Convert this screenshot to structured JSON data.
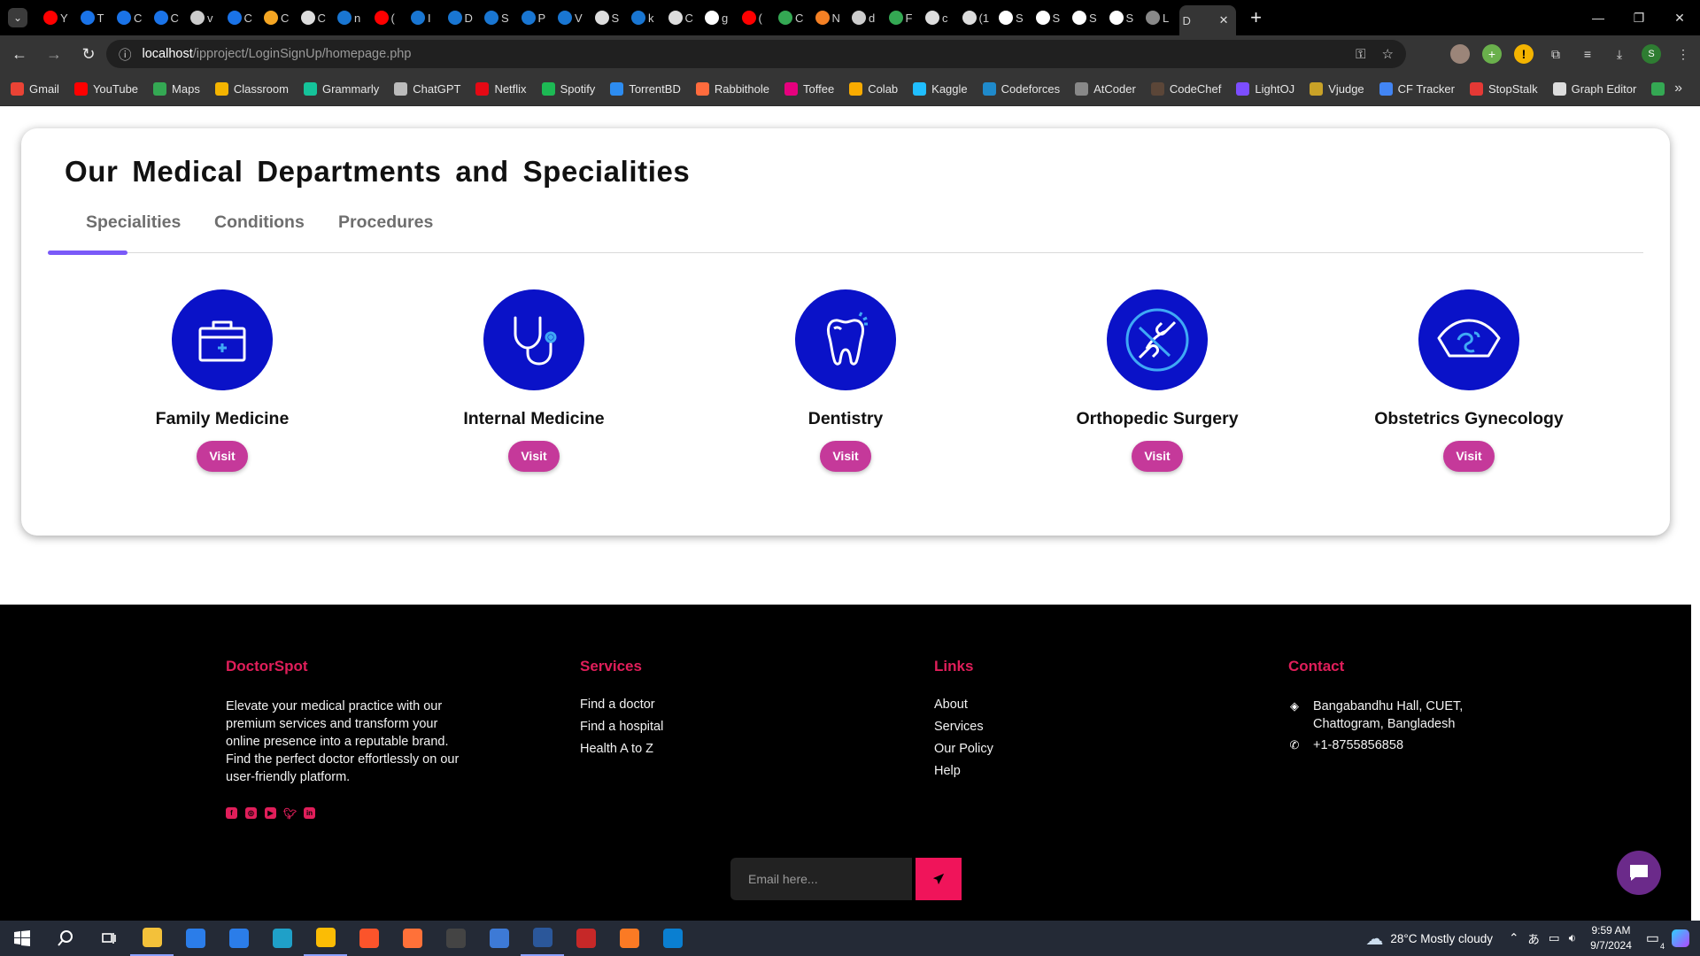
{
  "browser": {
    "tabs": [
      {
        "glyph": "Y",
        "color": "#ff0000"
      },
      {
        "glyph": "T",
        "color": "#1a73e8"
      },
      {
        "glyph": "C",
        "color": "#1a73e8"
      },
      {
        "glyph": "C",
        "color": "#1a73e8"
      },
      {
        "glyph": "v",
        "color": "#cccccc"
      },
      {
        "glyph": "C",
        "color": "#1a73e8"
      },
      {
        "glyph": "C",
        "color": "#f5a623"
      },
      {
        "glyph": "C",
        "color": "#dddddd"
      },
      {
        "glyph": "n",
        "color": "#1976d2"
      },
      {
        "glyph": "(",
        "color": "#ff0000"
      },
      {
        "glyph": "I",
        "color": "#1976d2"
      },
      {
        "glyph": "D",
        "color": "#1976d2"
      },
      {
        "glyph": "S",
        "color": "#1976d2"
      },
      {
        "glyph": "P",
        "color": "#1976d2"
      },
      {
        "glyph": "V",
        "color": "#1976d2"
      },
      {
        "glyph": "S",
        "color": "#dddddd"
      },
      {
        "glyph": "k",
        "color": "#1976d2"
      },
      {
        "glyph": "C",
        "color": "#dddddd"
      },
      {
        "glyph": "g",
        "color": "#ffffff"
      },
      {
        "glyph": "(",
        "color": "#ff0000"
      },
      {
        "glyph": "C",
        "color": "#34a853"
      },
      {
        "glyph": "N",
        "color": "#f48024"
      },
      {
        "glyph": "d",
        "color": "#cccccc"
      },
      {
        "glyph": "F",
        "color": "#34a853"
      },
      {
        "glyph": "c",
        "color": "#dddddd"
      },
      {
        "glyph": "(1",
        "color": "#dddddd"
      },
      {
        "glyph": "S",
        "color": "#ffffff"
      },
      {
        "glyph": "S",
        "color": "#ffffff"
      },
      {
        "glyph": "S",
        "color": "#ffffff"
      },
      {
        "glyph": "S",
        "color": "#ffffff"
      },
      {
        "glyph": "L",
        "color": "#888888"
      }
    ],
    "active_tab_glyph": "D",
    "url_host": "localhost",
    "url_path": "/ipproject/LoginSignUp/homepage.php",
    "profile_initial": "S"
  },
  "bookmarks": [
    {
      "label": "Gmail",
      "color": "#ea4335"
    },
    {
      "label": "YouTube",
      "color": "#ff0000"
    },
    {
      "label": "Maps",
      "color": "#34a853"
    },
    {
      "label": "Classroom",
      "color": "#f4b400"
    },
    {
      "label": "Grammarly",
      "color": "#15c39a"
    },
    {
      "label": "ChatGPT",
      "color": "#bbbbbb"
    },
    {
      "label": "Netflix",
      "color": "#e50914"
    },
    {
      "label": "Spotify",
      "color": "#1db954"
    },
    {
      "label": "TorrentBD",
      "color": "#2d8cf0"
    },
    {
      "label": "Rabbithole",
      "color": "#ff6b3d"
    },
    {
      "label": "Toffee",
      "color": "#e6007e"
    },
    {
      "label": "Colab",
      "color": "#f9ab00"
    },
    {
      "label": "Kaggle",
      "color": "#20beff"
    },
    {
      "label": "Codeforces",
      "color": "#1f8acb"
    },
    {
      "label": "AtCoder",
      "color": "#888888"
    },
    {
      "label": "CodeChef",
      "color": "#5b4638"
    },
    {
      "label": "LightOJ",
      "color": "#7c4dff"
    },
    {
      "label": "Vjudge",
      "color": "#c9a227"
    },
    {
      "label": "CF Tracker",
      "color": "#4285f4"
    },
    {
      "label": "StopStalk",
      "color": "#e53935"
    },
    {
      "label": "Graph Editor",
      "color": "#dddddd"
    },
    {
      "label": "",
      "color": "#34a853"
    }
  ],
  "departments": {
    "title": "Our Medical Departments and Specialities",
    "tabs": [
      "Specialities",
      "Conditions",
      "Procedures"
    ],
    "active_tab": "Specialities",
    "specialities": [
      {
        "name": "Family Medicine",
        "icon": "medical-kit-icon",
        "button": "Visit"
      },
      {
        "name": "Internal Medicine",
        "icon": "stethoscope-icon",
        "button": "Visit"
      },
      {
        "name": "Dentistry",
        "icon": "tooth-icon",
        "button": "Visit"
      },
      {
        "name": "Orthopedic Surgery",
        "icon": "bone-joint-icon",
        "button": "Visit"
      },
      {
        "name": "Obstetrics Gynecology",
        "icon": "ultrasound-icon",
        "button": "Visit"
      }
    ],
    "icon_color": "#0a12c8",
    "button_color": "#c5399a"
  },
  "footer": {
    "brand": {
      "heading": "DoctorSpot",
      "text": "Elevate your medical practice with our premium services and transform your online presence into a reputable brand. Find the perfect doctor effortlessly on our user-friendly platform.",
      "social": [
        "facebook-icon",
        "instagram-icon",
        "youtube-icon",
        "twitter-icon",
        "linkedin-icon"
      ]
    },
    "services": {
      "heading": "Services",
      "items": [
        "Find a doctor",
        "Find a hospital",
        "Health A to Z"
      ]
    },
    "links": {
      "heading": "Links",
      "items": [
        "About",
        "Services",
        "Our Policy",
        "Help"
      ]
    },
    "contact": {
      "heading": "Contact",
      "address": "Bangabandhu Hall, CUET, Chattogram, Bangladesh",
      "phone": "+1-8755856858"
    },
    "newsletter_placeholder": "Email here...",
    "accent": "#e01e5a"
  },
  "taskbar": {
    "apps": [
      {
        "name": "file-explorer-icon",
        "color": "#f3c13a",
        "running": true
      },
      {
        "name": "store-icon",
        "color": "#2b7de9",
        "running": false
      },
      {
        "name": "mail-icon",
        "color": "#2b7de9",
        "running": false
      },
      {
        "name": "edge-icon",
        "color": "#1fa0c8",
        "running": false
      },
      {
        "name": "chrome-icon",
        "color": "#fbbc05",
        "running": true
      },
      {
        "name": "brave-icon",
        "color": "#fb542b",
        "running": false
      },
      {
        "name": "firefox-icon",
        "color": "#ff7139",
        "running": false
      },
      {
        "name": "terminal-icon",
        "color": "#444444",
        "running": false
      },
      {
        "name": "qbittorrent-icon",
        "color": "#3d7ad6",
        "running": false
      },
      {
        "name": "word-icon",
        "color": "#2b579a",
        "running": true
      },
      {
        "name": "typora-icon",
        "color": "#c62828",
        "running": false
      },
      {
        "name": "xampp-icon",
        "color": "#fb7a24",
        "running": false
      },
      {
        "name": "vscode-icon",
        "color": "#0a7fd1",
        "running": false
      }
    ],
    "weather": "28°C  Mostly cloudy",
    "time": "9:59 AM",
    "date": "9/7/2024",
    "notification_count": "4"
  }
}
